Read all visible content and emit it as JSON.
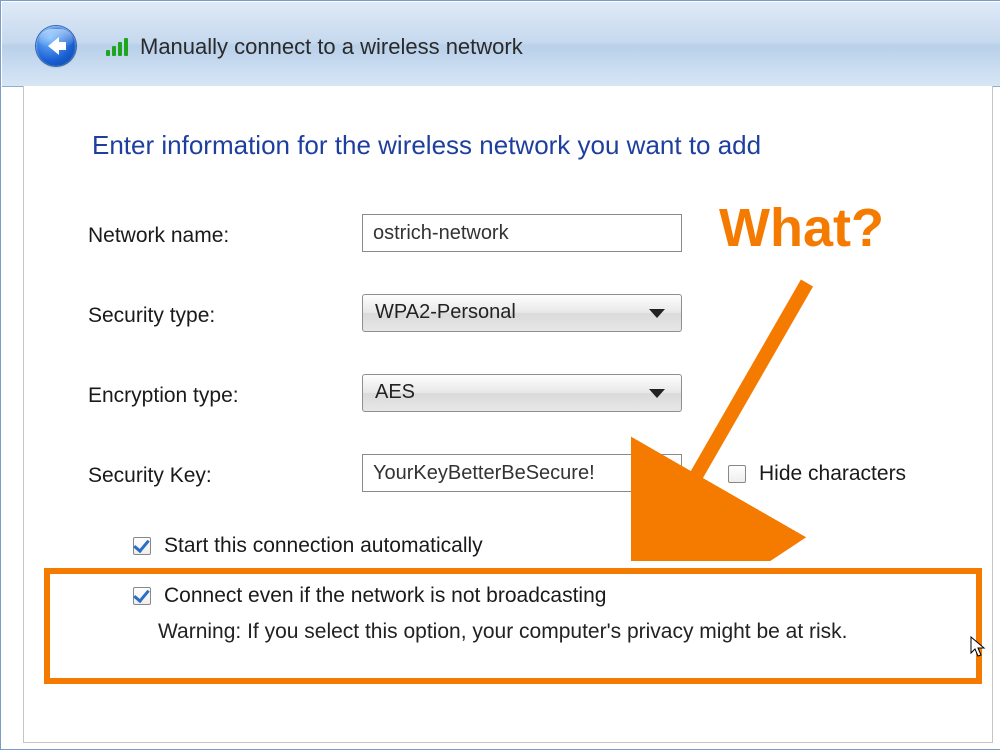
{
  "window": {
    "title": "Manually connect to a wireless network"
  },
  "heading": "Enter information for the wireless network you want to add",
  "labels": {
    "network_name": "Network name:",
    "security_type": "Security type:",
    "encryption_type": "Encryption type:",
    "security_key": "Security Key:"
  },
  "fields": {
    "network_name": "ostrich-network",
    "security_type": "WPA2-Personal",
    "encryption_type": "AES",
    "security_key": "YourKeyBetterBeSecure!"
  },
  "checkboxes": {
    "hide_characters": {
      "label": "Hide characters",
      "checked": false
    },
    "start_auto": {
      "label": "Start this connection automatically",
      "checked": true
    },
    "connect_even": {
      "label": "Connect even if the network is not broadcasting",
      "checked": true
    }
  },
  "warning": "Warning: If you select this option, your computer's privacy might be at risk.",
  "annotation": {
    "text": "What?",
    "color": "#f47b00"
  }
}
